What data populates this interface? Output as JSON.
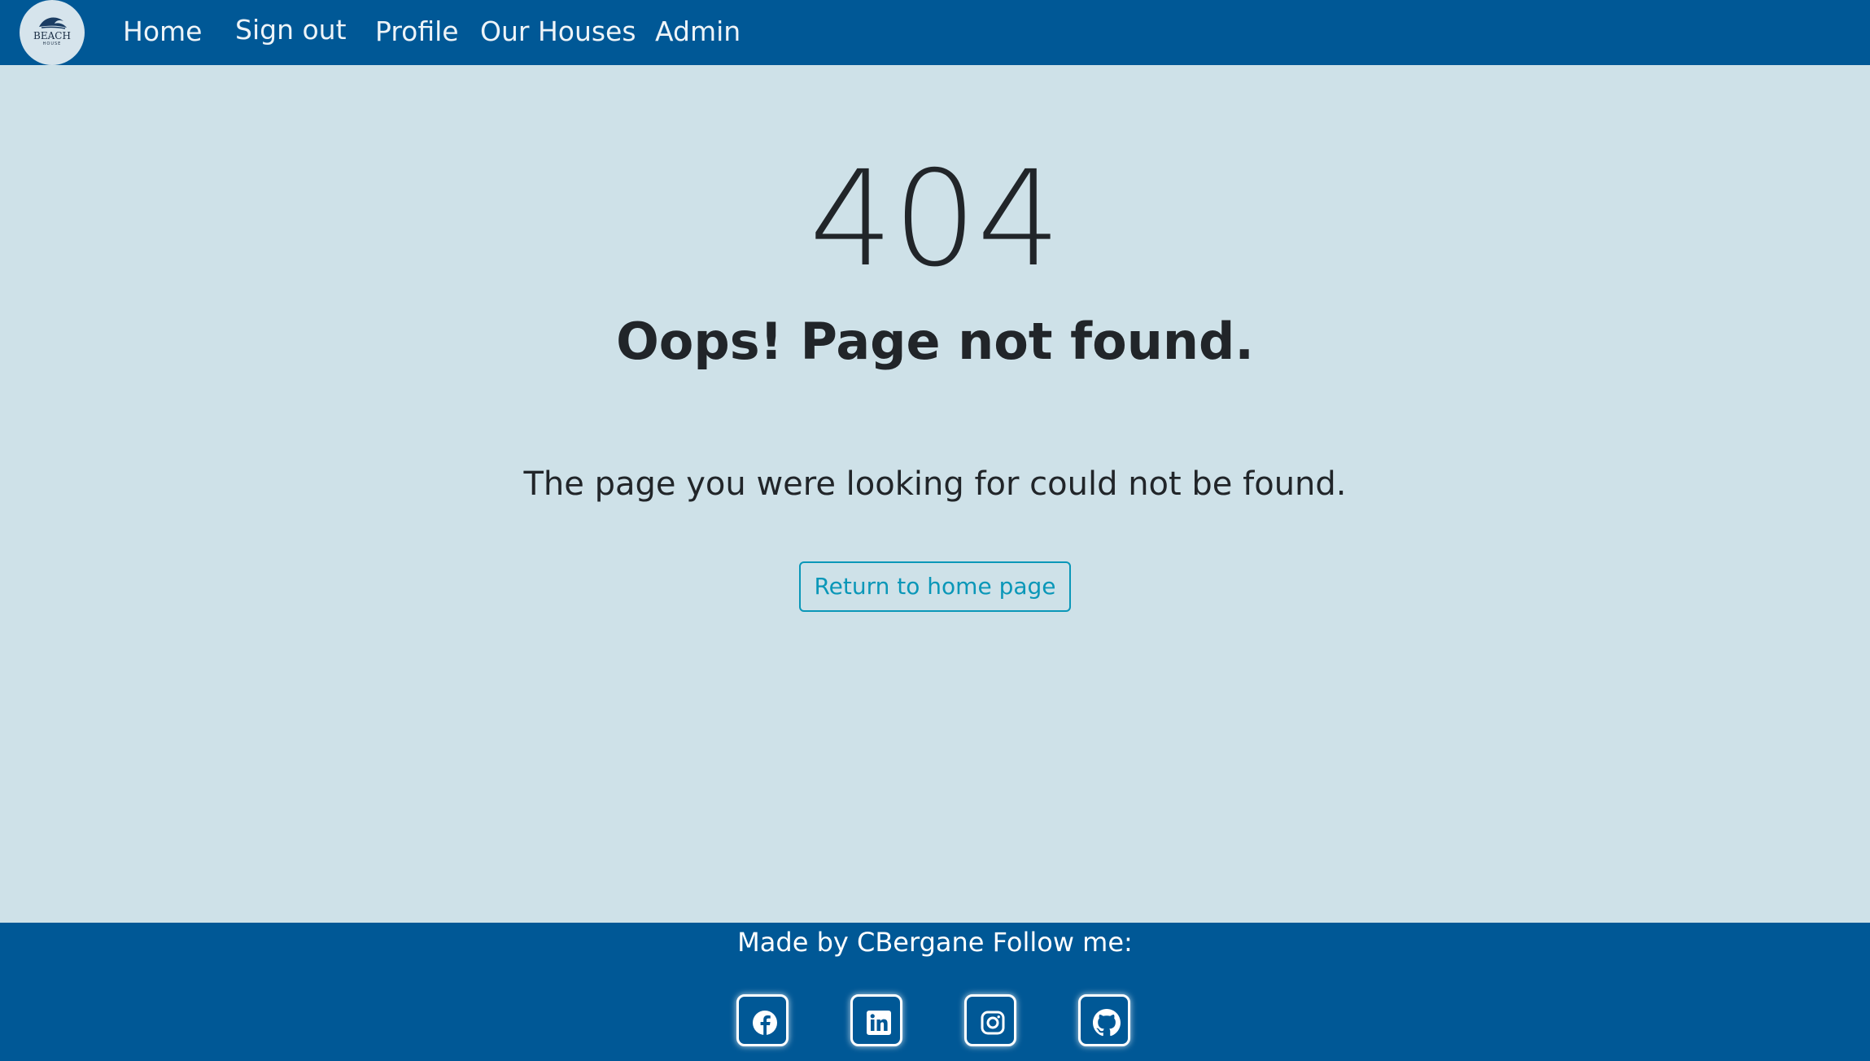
{
  "brand": {
    "logo_text": "BEACH",
    "logo_subtext": "HOUSE"
  },
  "nav": {
    "home": "Home",
    "sign_out": "Sign out",
    "profile": "Profile",
    "our_houses": "Our Houses",
    "admin": "Admin"
  },
  "error": {
    "code": "404",
    "title": "Oops! Page not found.",
    "message": "The page you were looking for could not be found.",
    "button_label": "Return to home page"
  },
  "footer": {
    "text": "Made by CBergane Follow me:",
    "social_icons": [
      "facebook-icon",
      "linkedin-icon",
      "instagram-icon",
      "github-icon"
    ]
  },
  "colors": {
    "navbar": "#005896",
    "background": "#cee1e8",
    "button_accent": "#0a97b8",
    "text": "#212529"
  }
}
